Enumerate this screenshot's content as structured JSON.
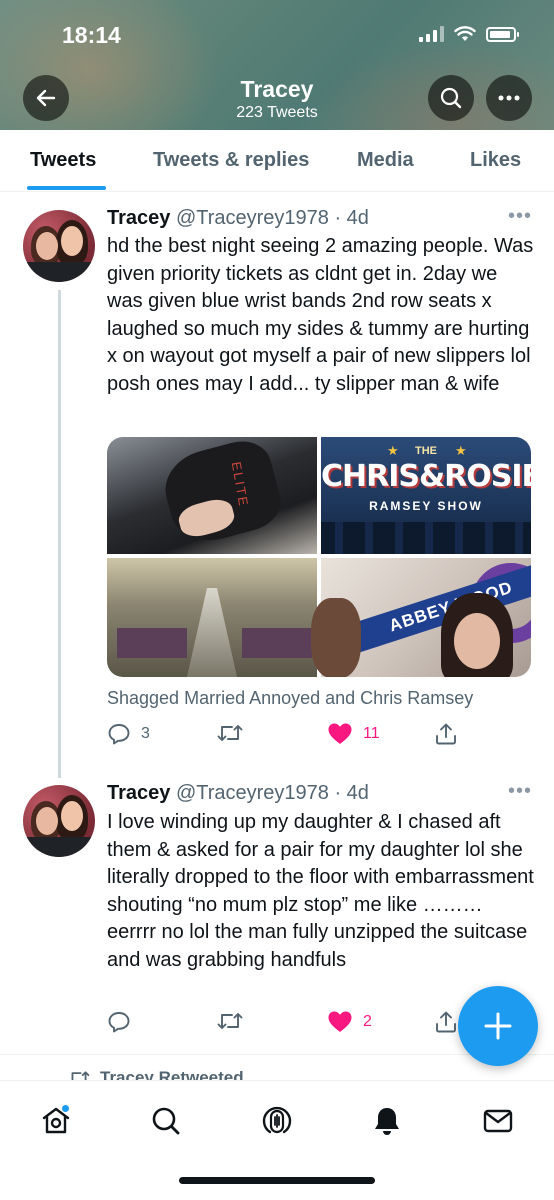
{
  "status_bar": {
    "time": "18:14"
  },
  "profile_header": {
    "name": "Tracey",
    "tweet_count": "223 Tweets"
  },
  "tabs": [
    {
      "label": "Tweets",
      "active": true
    },
    {
      "label": "Tweets & replies",
      "active": false
    },
    {
      "label": "Media",
      "active": false
    },
    {
      "label": "Likes",
      "active": false
    }
  ],
  "tweets": [
    {
      "name": "Tracey",
      "handle_time": "@Traceyrey1978 · 4d",
      "text": "hd the best night seeing 2 amazing people. Was given priority tickets as cldnt get in. 2day we was given blue wrist bands 2nd row seats x laughed so much my sides & tummy are hurting x on wayout got myself a pair of new slippers lol posh ones may I add... ty slipper man & wife",
      "media": {
        "photo1_text": "ELITE",
        "photo2_the": "THE",
        "photo2_logo": "CHRIS&ROSIE",
        "photo2_sub": "RAMSEY SHOW",
        "photo4_sign": "ABBEY WOOD"
      },
      "tagged": "Shagged Married Annoyed and Chris Ramsey",
      "replies": "3",
      "retweets": "",
      "likes": "11"
    },
    {
      "name": "Tracey",
      "handle_time": "@Traceyrey1978 · 4d",
      "text": "I love winding up my daughter & I chased aft them & asked for a pair for my daughter lol she literally dropped to the floor with embarrassment shouting “no mum plz stop” me like ……… eerrrr no lol the man fully unzipped the suitcase and was grabbing handfuls",
      "replies": "",
      "retweets": "",
      "likes": "2"
    }
  ],
  "retweeted_label": "Tracey Retweeted",
  "colors": {
    "accent": "#1d9bf0",
    "like": "#f91880",
    "secondary_text": "#536471"
  },
  "icons": [
    "back-arrow-icon",
    "search-icon",
    "more-icon",
    "reply-icon",
    "retweet-icon",
    "heart-icon",
    "share-icon",
    "compose-icon",
    "home-icon",
    "explore-icon",
    "spaces-icon",
    "notifications-icon",
    "messages-icon"
  ]
}
